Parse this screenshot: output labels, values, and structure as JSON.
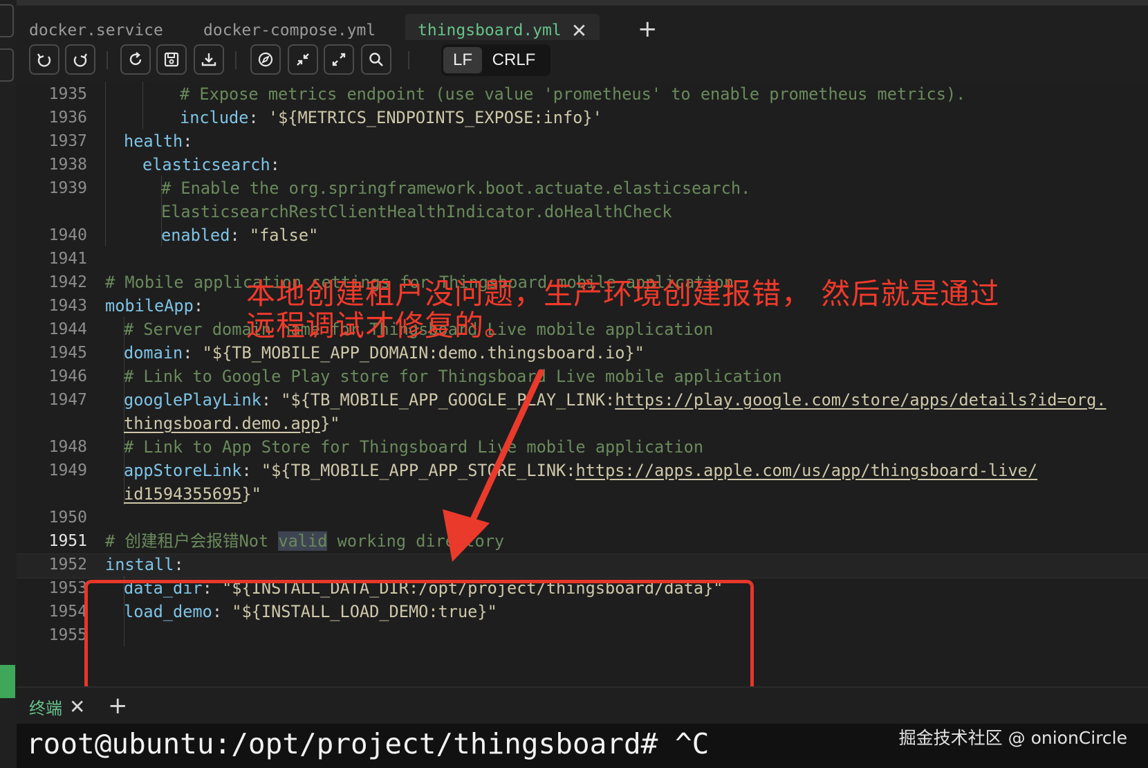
{
  "tabs": [
    {
      "label": "docker.service",
      "active": false
    },
    {
      "label": "docker-compose.yml",
      "active": false
    },
    {
      "label": "thingsboard.yml",
      "active": true
    }
  ],
  "toolbar": {
    "icons": [
      "undo-icon",
      "redo-icon",
      "reload-icon",
      "save-icon",
      "download-icon",
      "compass-icon",
      "collapse-icon",
      "expand-icon",
      "search-icon"
    ],
    "eol_options": [
      "LF",
      "CRLF"
    ],
    "eol_selected": "LF"
  },
  "editor": {
    "lines": [
      {
        "num": "1935",
        "text": "# Expose metrics endpoint (use value 'prometheus' to enable prometheus metrics)."
      },
      {
        "num": "1936",
        "key": "include",
        "value": "'${METRICS_ENDPOINTS_EXPOSE:info}'"
      },
      {
        "num": "1937",
        "key": "health"
      },
      {
        "num": "1938",
        "key": "elasticsearch"
      },
      {
        "num": "1939",
        "text": "# Enable the org.springframework.boot.actuate.elasticsearch.",
        "text2": "ElasticsearchRestClientHealthIndicator.doHealthCheck"
      },
      {
        "num": "1940",
        "key": "enabled",
        "value": "\"false\""
      },
      {
        "num": "1941"
      },
      {
        "num": "1942",
        "text": "# Mobile application settings for Thingsboard mobile application"
      },
      {
        "num": "1943",
        "key": "mobileApp"
      },
      {
        "num": "1944",
        "text": "# Server domain name for Thingsboard Live mobile application"
      },
      {
        "num": "1945",
        "key": "domain",
        "value": "\"${TB_MOBILE_APP_DOMAIN:demo.thingsboard.io}\""
      },
      {
        "num": "1946",
        "text": "# Link to Google Play store for Thingsboard Live mobile application"
      },
      {
        "num": "1947",
        "key": "googlePlayLink",
        "value_pre": "\"${TB_MOBILE_APP_GOOGLE_PLAY_LINK:",
        "url1": "https://play.google.com/store/apps/details?id=org.",
        "url2": "thingsboard.demo.app",
        "value_post": "}\""
      },
      {
        "num": "1948",
        "text": "# Link to App Store for Thingsboard Live mobile application"
      },
      {
        "num": "1949",
        "key": "appStoreLink",
        "value_pre": "\"${TB_MOBILE_APP_APP_STORE_LINK:",
        "url1": "https://apps.apple.com/us/app/thingsboard-live/",
        "url2": "id1594355695",
        "value_post": "}\""
      },
      {
        "num": "1950"
      },
      {
        "num": "1951",
        "text_pre": "# 创建租户会报错Not ",
        "text_sel": "valid",
        "text_post": " working directory"
      },
      {
        "num": "1952",
        "key": "install"
      },
      {
        "num": "1953",
        "key": "data_dir",
        "value": "\"${INSTALL_DATA_DIR:/opt/project/thingsboard/data}\""
      },
      {
        "num": "1954",
        "key": "load_demo",
        "value": "\"${INSTALL_LOAD_DEMO:true}\""
      },
      {
        "num": "1955"
      }
    ]
  },
  "annotation": {
    "line1": "本地创建租户没问题，生产环境创建报错， 然后就是通过",
    "line2": "远程调试才修复的。"
  },
  "panel": {
    "tab_label": "终端"
  },
  "terminal": {
    "line": "root@ubuntu:/opt/project/thingsboard# ^C"
  },
  "watermark": "掘金技术社区 @ onionCircle",
  "colors": {
    "accent_green": "#67c38a",
    "annotation_red": "#e5372a",
    "comment": "#6a8a5c",
    "key": "#7ec4e6",
    "string": "#cfc8aa"
  }
}
